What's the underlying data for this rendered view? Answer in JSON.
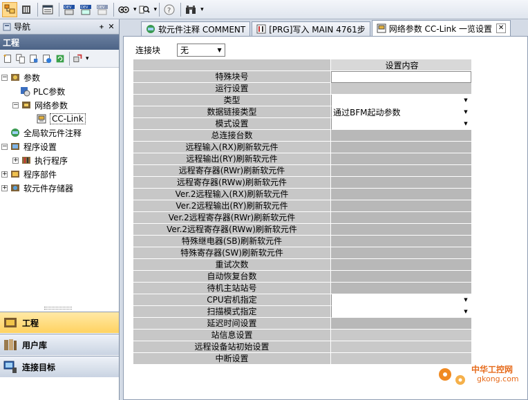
{
  "toolbar": {
    "icons": [
      "project-icon",
      "module-icon",
      "list-icon",
      "dev-icon",
      "dev-monitor-icon",
      "dev-test-icon",
      "watch-icon",
      "find-icon",
      "help-icon",
      "binoculars-icon"
    ],
    "dev_label": "DEV"
  },
  "navigation": {
    "title": "导航",
    "pin": "ᚐ",
    "close": "✕",
    "project_header": "工程",
    "tree": [
      {
        "label": "参数",
        "depth": 0,
        "expander": "−"
      },
      {
        "label": "PLC参数",
        "depth": 1,
        "expander": ""
      },
      {
        "label": "网络参数",
        "depth": 1,
        "expander": "−"
      },
      {
        "label": "CC-Link",
        "depth": 2,
        "expander": "",
        "selected": true
      },
      {
        "label": "全局软元件注释",
        "depth": 0,
        "expander": ""
      },
      {
        "label": "程序设置",
        "depth": 0,
        "expander": "−"
      },
      {
        "label": "执行程序",
        "depth": 1,
        "expander": "+"
      },
      {
        "label": "程序部件",
        "depth": 0,
        "expander": "+"
      },
      {
        "label": "软元件存储器",
        "depth": 0,
        "expander": "+"
      }
    ],
    "bottom": [
      {
        "label": "工程"
      },
      {
        "label": "用户库"
      },
      {
        "label": "连接目标"
      }
    ]
  },
  "tabs": [
    {
      "label": "软元件注释 COMMENT"
    },
    {
      "label": "[PRG]写入 MAIN 4761步"
    },
    {
      "label": "网络参数  CC-Link 一览设置",
      "close": "✕"
    }
  ],
  "editor": {
    "link_label": "连接块",
    "link_value": "无",
    "column_header": "设置内容",
    "rows": [
      {
        "label": "特殊块号",
        "value": "",
        "kind": "input"
      },
      {
        "label": "运行设置",
        "value": "",
        "kind": "hl"
      },
      {
        "label": "类型",
        "value": "",
        "kind": "dropdown"
      },
      {
        "label": "数据链接类型",
        "value": "通过BFM起动参数",
        "kind": "dropdown"
      },
      {
        "label": "模式设置",
        "value": "",
        "kind": "dropdown"
      },
      {
        "label": "总连接台数",
        "value": "",
        "kind": "plain"
      },
      {
        "label": "远程输入(RX)刷新软元件",
        "value": "",
        "kind": "plain"
      },
      {
        "label": "远程输出(RY)刷新软元件",
        "value": "",
        "kind": "plain"
      },
      {
        "label": "远程寄存器(RWr)刷新软元件",
        "value": "",
        "kind": "plain"
      },
      {
        "label": "远程寄存器(RWw)刷新软元件",
        "value": "",
        "kind": "plain"
      },
      {
        "label": "Ver.2远程输入(RX)刷新软元件",
        "value": "",
        "kind": "plain"
      },
      {
        "label": "Ver.2远程输出(RY)刷新软元件",
        "value": "",
        "kind": "plain"
      },
      {
        "label": "Ver.2远程寄存器(RWr)刷新软元件",
        "value": "",
        "kind": "plain"
      },
      {
        "label": "Ver.2远程寄存器(RWw)刷新软元件",
        "value": "",
        "kind": "plain"
      },
      {
        "label": "特殊继电器(SB)刷新软元件",
        "value": "",
        "kind": "plain"
      },
      {
        "label": "特殊寄存器(SW)刷新软元件",
        "value": "",
        "kind": "plain"
      },
      {
        "label": "重试次数",
        "value": "",
        "kind": "plain"
      },
      {
        "label": "自动恢复台数",
        "value": "",
        "kind": "plain"
      },
      {
        "label": "待机主站站号",
        "value": "",
        "kind": "plain"
      },
      {
        "label": "CPU宕机指定",
        "value": "",
        "kind": "dropdown"
      },
      {
        "label": "扫描模式指定",
        "value": "",
        "kind": "dropdown"
      },
      {
        "label": "延迟时间设置",
        "value": "",
        "kind": "plain"
      },
      {
        "label": "站信息设置",
        "value": "",
        "kind": "hl"
      },
      {
        "label": "远程设备站初始设置",
        "value": "",
        "kind": "hl"
      },
      {
        "label": "中断设置",
        "value": "",
        "kind": "hl"
      }
    ]
  },
  "watermark": {
    "line1": "中华工控网",
    "line2": "gkong.com"
  }
}
